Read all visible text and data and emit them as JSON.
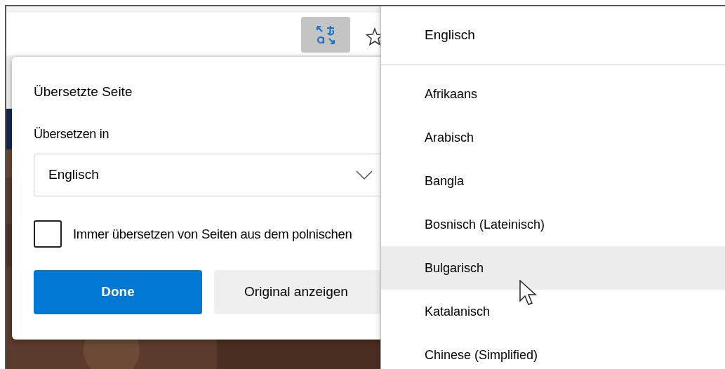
{
  "popup": {
    "title": "Übersetzte Seite",
    "target_label": "Übersetzen in",
    "target_value": "Englisch",
    "always_translate": {
      "label": "Immer übersetzen von Seiten aus dem polnischen",
      "checked": false
    },
    "buttons": [
      {
        "label": "Done",
        "kind": "primary"
      },
      {
        "label": "Original anzeigen",
        "kind": "secondary"
      }
    ]
  },
  "language_list": {
    "current": "Englisch",
    "items": [
      {
        "label": "Afrikaans",
        "selected": false
      },
      {
        "label": "Arabisch",
        "selected": false
      },
      {
        "label": "Bangla",
        "selected": false
      },
      {
        "label": "Bosnisch (Lateinisch)",
        "selected": false
      },
      {
        "label": "Bulgarisch",
        "selected": true
      },
      {
        "label": "Katalanisch",
        "selected": false
      },
      {
        "label": "Chinese (Simplified)",
        "selected": false
      }
    ]
  }
}
